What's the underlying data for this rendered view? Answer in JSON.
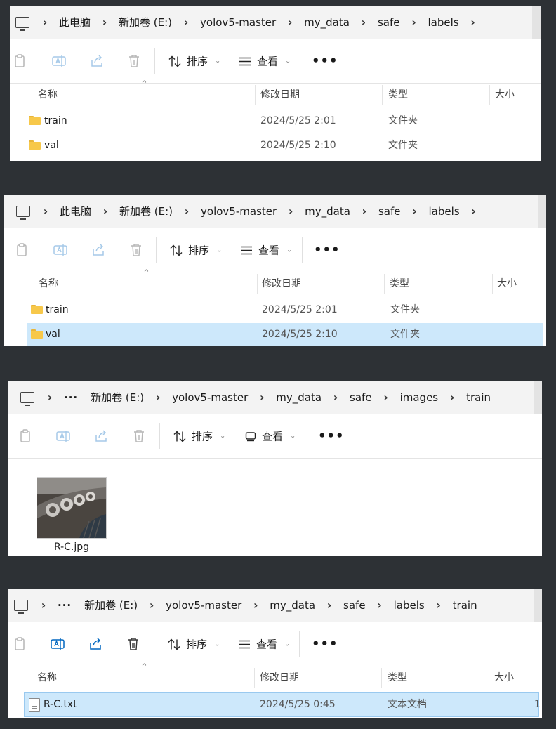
{
  "panels": [
    {
      "breadcrumb": [
        "此电脑",
        "新加卷 (E:)",
        "yolov5-master",
        "my_data",
        "safe",
        "labels"
      ],
      "toolbar": {
        "sort_label": "排序",
        "view_label": "查看",
        "more_label": "•••"
      },
      "columns": {
        "name": "名称",
        "date": "修改日期",
        "type": "类型",
        "size": "大小"
      },
      "rows": [
        {
          "name": "train",
          "date": "2024/5/25 2:01",
          "type": "文件夹"
        },
        {
          "name": "val",
          "date": "2024/5/25 2:10",
          "type": "文件夹"
        }
      ]
    },
    {
      "breadcrumb": [
        "此电脑",
        "新加卷 (E:)",
        "yolov5-master",
        "my_data",
        "safe",
        "labels"
      ],
      "toolbar": {
        "sort_label": "排序",
        "view_label": "查看",
        "more_label": "•••"
      },
      "columns": {
        "name": "名称",
        "date": "修改日期",
        "type": "类型",
        "size": "大小"
      },
      "rows": [
        {
          "name": "train",
          "date": "2024/5/25 2:01",
          "type": "文件夹"
        },
        {
          "name": "val",
          "date": "2024/5/25 2:10",
          "type": "文件夹",
          "selected": true
        }
      ]
    },
    {
      "overflow_crumb": "···",
      "breadcrumb": [
        "新加卷 (E:)",
        "yolov5-master",
        "my_data",
        "safe",
        "images",
        "train"
      ],
      "toolbar": {
        "sort_label": "排序",
        "view_label": "查看",
        "more_label": "•••"
      },
      "files": [
        {
          "name": "R-C.jpg"
        }
      ]
    },
    {
      "overflow_crumb": "···",
      "breadcrumb": [
        "新加卷 (E:)",
        "yolov5-master",
        "my_data",
        "safe",
        "labels",
        "train"
      ],
      "toolbar": {
        "sort_label": "排序",
        "view_label": "查看",
        "more_label": "•••"
      },
      "columns": {
        "name": "名称",
        "date": "修改日期",
        "type": "类型",
        "size": "大小"
      },
      "rows": [
        {
          "name": "R-C.txt",
          "date": "2024/5/25 0:45",
          "type": "文本文档",
          "size": "1",
          "selected": true
        }
      ]
    }
  ],
  "colors": {
    "background": "#2d3135",
    "selection": "#cde8fb",
    "folder": "#f7c84a"
  }
}
